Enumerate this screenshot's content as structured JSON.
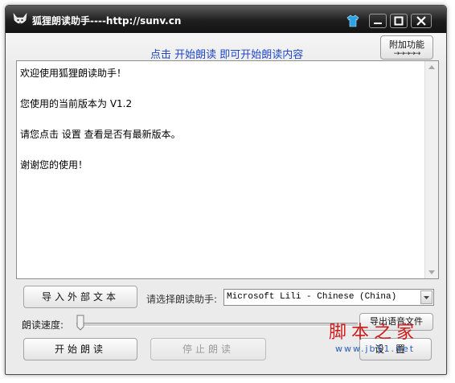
{
  "window": {
    "title": "狐狸朗读助手----http://sunv.cn"
  },
  "header": {
    "hint": "点击 开始朗读 即可开始朗读内容",
    "extra_button": "附加功能",
    "extra_arrows": "→→→→→"
  },
  "editor": {
    "lines": [
      "欢迎使用狐狸朗读助手！",
      "",
      "您使用的当前版本为 V1.2",
      "",
      "请您点击 设置 查看是否有最新版本。",
      "",
      "谢谢您的使用！"
    ]
  },
  "controls": {
    "import_button": "导入外部文本",
    "select_label": "请选择朗读助手:",
    "voice_selected": "Microsoft Lili - Chinese (China)",
    "speed_label": "朗读速度:",
    "speed_level": 0,
    "export_button": "导出语音文件",
    "start_button": "开始朗读",
    "stop_button": "停止朗读",
    "settings_button": "设置"
  },
  "watermark": {
    "main": "脚本之家",
    "sub": "www.jb51.net"
  },
  "colors": {
    "hint": "#1f47c8",
    "watermark_main": "#d11a1a",
    "watermark_sub": "#2a5dbd"
  }
}
